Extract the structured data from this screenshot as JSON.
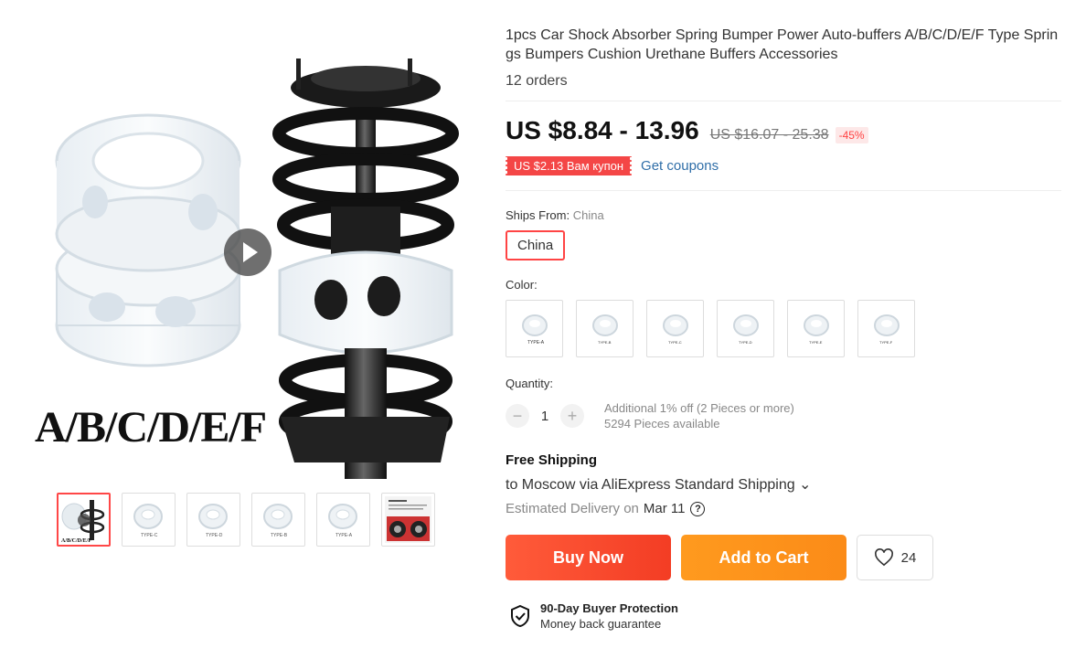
{
  "product": {
    "title": "1pcs Car Shock Absorber Spring Bumper Power Auto-buffers A/B/C/D/E/F Type Springs Bumpers Cushion Urethane Buffers Accessories",
    "orders": "12 orders",
    "image_caption": "A/B/C/D/E/F"
  },
  "gallery": {
    "thumbs": [
      {
        "name": "A/B/C/D/E/F",
        "active": true
      },
      {
        "name": "TYPE-C"
      },
      {
        "name": "TYPE-D"
      },
      {
        "name": "TYPE-B"
      },
      {
        "name": "TYPE-A"
      },
      {
        "name": "installation"
      }
    ]
  },
  "price": {
    "current": "US $8.84 - 13.96",
    "original": "US $16.07 - 25.38",
    "discount": "-45%"
  },
  "coupon": {
    "label": "US $2.13 Вам купон",
    "link": "Get coupons"
  },
  "ships_from": {
    "label": "Ships From:",
    "value": "China",
    "option": "China"
  },
  "color": {
    "label": "Color:",
    "options": [
      "TYPE-A",
      "TYPE-B",
      "TYPE-C",
      "TYPE-D",
      "TYPE-E",
      "TYPE-F"
    ]
  },
  "quantity": {
    "label": "Quantity:",
    "value": "1",
    "minus": "−",
    "plus": "+",
    "discount_note": "Additional 1% off (2 Pieces or more)",
    "available": "5294 Pieces available"
  },
  "shipping": {
    "title": "Free Shipping",
    "to": "to Moscow via AliExpress Standard Shipping ⌄",
    "estimated_label": "Estimated Delivery on",
    "date": "Mar 11",
    "help": "?"
  },
  "actions": {
    "buy_now": "Buy Now",
    "add_to_cart": "Add to Cart",
    "wishlist_count": "24"
  },
  "protection": {
    "title": "90-Day Buyer Protection",
    "subtitle": "Money back guarantee"
  },
  "colors": {
    "accent": "#ff4747",
    "buy": "#f5482c",
    "cart": "#fd9218",
    "link": "#2f6ea8"
  }
}
